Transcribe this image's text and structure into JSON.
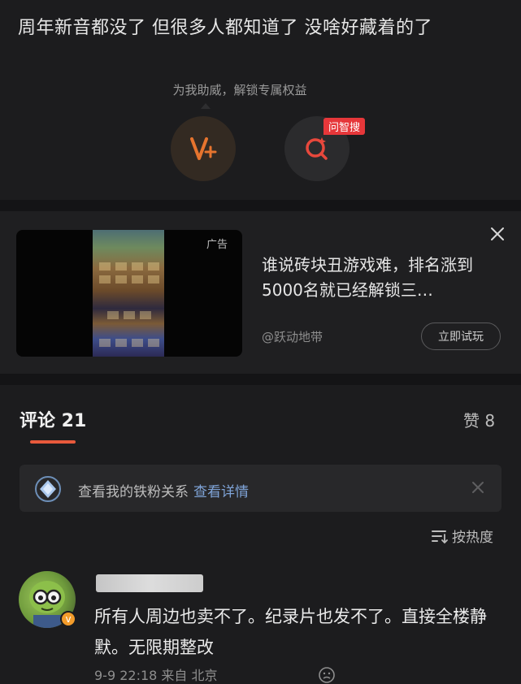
{
  "post": {
    "text": "周年新音都没了 但很多人都知道了 没啥好藏着的了"
  },
  "boost": {
    "tip": "为我助威，解锁专属权益",
    "v_icon": "v-plus-icon",
    "search_icon": "ai-search-icon",
    "ask_badge": "问智搜"
  },
  "ad": {
    "label": "广告",
    "title": "谁说砖块丑游戏难，排名涨到5000名就已经解锁三…",
    "source": "@跃动地带",
    "cta": "立即试玩",
    "close_icon": "close-icon"
  },
  "comments_header": {
    "tab_label": "评论 21",
    "likes_label": "赞 8",
    "accent": "#e85a3c"
  },
  "fan_bar": {
    "text": "查看我的铁粉关系",
    "link": "查看详情"
  },
  "sort": {
    "label": "按热度"
  },
  "comment": {
    "body": "所有人周边也卖不了。纪录片也发不了。直接全楼静默。无限期整改",
    "meta": "9-9 22:18 来自 北京",
    "badge": "v"
  }
}
